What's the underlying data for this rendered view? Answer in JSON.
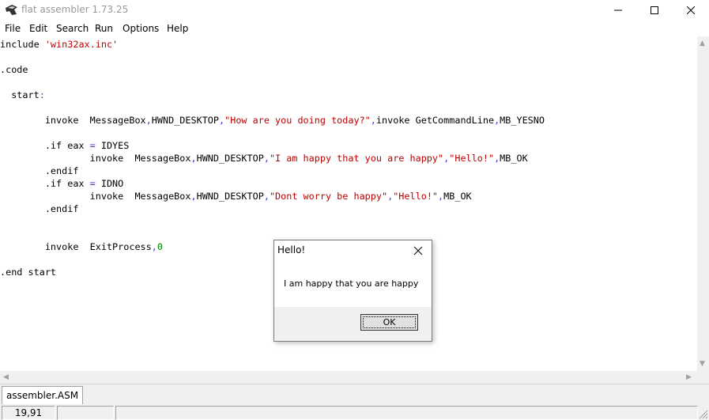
{
  "window": {
    "title": "flat assembler 1.73.25"
  },
  "menu": {
    "items": [
      "File",
      "Edit",
      "Search",
      "Run",
      "Options",
      "Help"
    ]
  },
  "editor": {
    "lines": [
      "include 'win32ax.inc'",
      "",
      ".code",
      "",
      "  start:",
      "",
      "        invoke  MessageBox,HWND_DESKTOP,\"How are you doing today?\",invoke GetCommandLine,MB_YESNO",
      "",
      "        .if eax = IDYES",
      "                invoke  MessageBox,HWND_DESKTOP,\"I am happy that you are happy\",\"Hello!\",MB_OK",
      "        .endif",
      "        .if eax = IDNO",
      "                invoke  MessageBox,HWND_DESKTOP,\"Dont worry be happy\",\"Hello!\",MB_OK",
      "        .endif",
      "",
      "",
      "        invoke  ExitProcess,0",
      "",
      ".end start"
    ]
  },
  "tabs": [
    {
      "label": "assembler.ASM"
    }
  ],
  "status": {
    "position": "19,91"
  },
  "dialog": {
    "title": "Hello!",
    "message": "I am happy that you are happy",
    "ok_label": "OK"
  },
  "colors": {
    "string": "#c00000",
    "operator": "#3c3cdc",
    "number": "#008000"
  }
}
